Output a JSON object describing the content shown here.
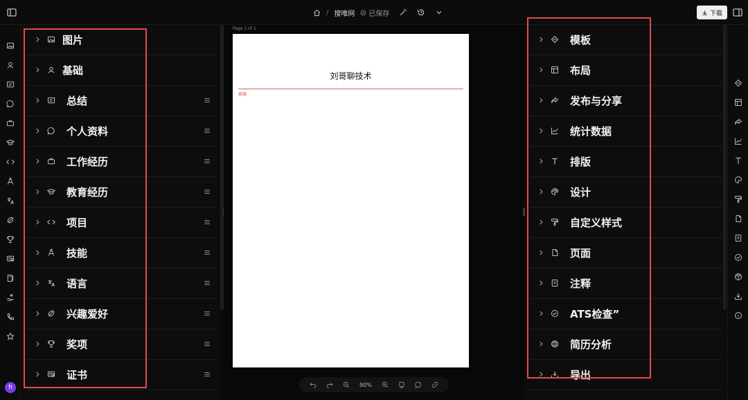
{
  "topbar": {
    "breadcrumb_home_icon": "home-icon",
    "separator": "/",
    "doc_title": "搜唯网",
    "saved_status": "已保存",
    "download_label": "下载"
  },
  "left_sections": [
    {
      "label": "图片",
      "icon": "image-icon",
      "draggable": false
    },
    {
      "label": "基础",
      "icon": "user-icon",
      "draggable": false
    },
    {
      "label": "总结",
      "icon": "summary-icon",
      "draggable": true
    },
    {
      "label": "个人资料",
      "icon": "chat-icon",
      "draggable": true
    },
    {
      "label": "工作经历",
      "icon": "briefcase-icon",
      "draggable": true
    },
    {
      "label": "教育经历",
      "icon": "graduation-cap-icon",
      "draggable": true
    },
    {
      "label": "项目",
      "icon": "code-icon",
      "draggable": true
    },
    {
      "label": "技能",
      "icon": "compass-icon",
      "draggable": true
    },
    {
      "label": "语言",
      "icon": "translate-icon",
      "draggable": true
    },
    {
      "label": "兴趣爱好",
      "icon": "leaf-icon",
      "draggable": true
    },
    {
      "label": "奖项",
      "icon": "trophy-icon",
      "draggable": true
    },
    {
      "label": "证书",
      "icon": "certificate-icon",
      "draggable": true
    }
  ],
  "right_sections": [
    {
      "label": "模板",
      "icon": "diamond-icon"
    },
    {
      "label": "布局",
      "icon": "layout-icon"
    },
    {
      "label": "发布与分享",
      "icon": "share-icon"
    },
    {
      "label": "统计数据",
      "icon": "chart-icon"
    },
    {
      "label": "排版",
      "icon": "type-icon"
    },
    {
      "label": "设计",
      "icon": "palette-icon"
    },
    {
      "label": "自定义样式",
      "icon": "paint-roller-icon"
    },
    {
      "label": "页面",
      "icon": "page-icon"
    },
    {
      "label": "注释",
      "icon": "note-icon"
    },
    {
      "label": "ATS检查”",
      "icon": "check-circle-icon"
    },
    {
      "label": "简历分析",
      "icon": "brain-icon"
    },
    {
      "label": "导出",
      "icon": "export-icon"
    }
  ],
  "canvas": {
    "page_label": "Page 1 of 1",
    "resume_name": "刘哥聊技术",
    "resume_subtitle": "总结"
  },
  "zoom": {
    "level": "90%"
  },
  "user": {
    "avatar_initial": "h"
  },
  "colors": {
    "highlight": "#e54b4b",
    "avatar": "#7c3aed",
    "accent_rule": "#e06060"
  }
}
